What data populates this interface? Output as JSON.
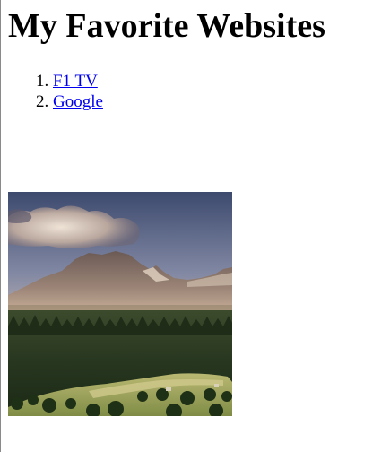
{
  "page": {
    "heading": "My Favorite Websites",
    "links": [
      {
        "label": "F1 TV"
      },
      {
        "label": "Google"
      }
    ]
  },
  "colors": {
    "link": "#0000ee",
    "text": "#000000",
    "background": "#ffffff"
  },
  "image": {
    "content": "mountain-landscape-photo"
  }
}
